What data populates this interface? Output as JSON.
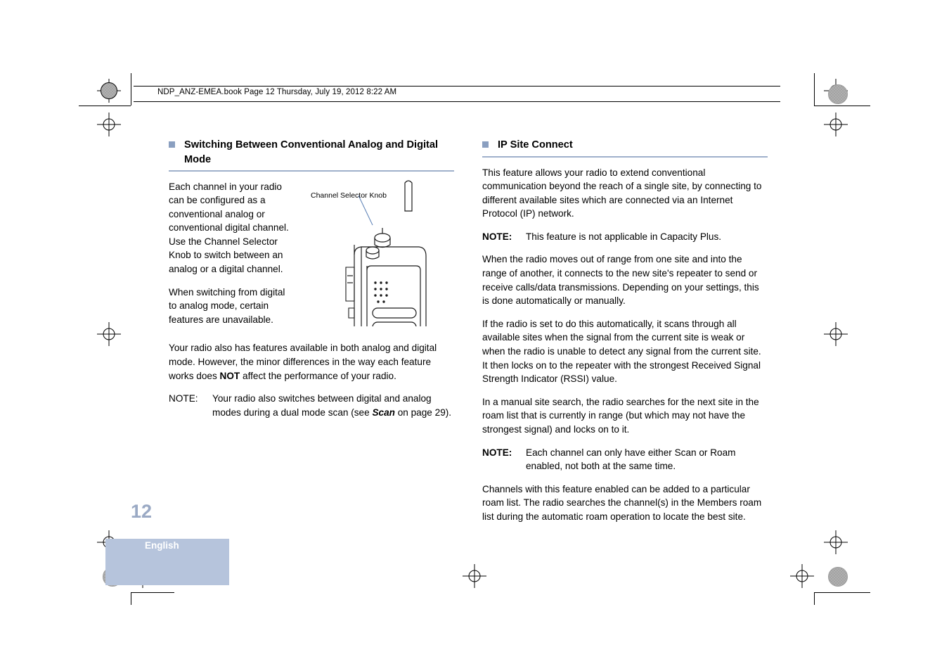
{
  "header": {
    "file_line": "NDP_ANZ-EMEA.book  Page 12  Thursday, July 19, 2012  8:22 AM"
  },
  "left_column": {
    "heading": "Switching Between Conventional Analog and Digital Mode",
    "p1": "Each channel in your radio can be configured as a conventional analog or conventional digital channel. Use the Channel Selector Knob to switch between an analog or a digital channel.",
    "p2": "When switching from digital to analog mode, certain features are unavailable.",
    "p3_part1": "Your radio also has features available in both analog and digital mode. However, the minor differences in the way each feature works does ",
    "p3_bold": "NOT",
    "p3_part2": " affect the performance of your radio.",
    "note_label": "NOTE:",
    "note_part1": "Your radio also switches between digital and analog modes during a dual mode scan (see ",
    "note_italic": "Scan",
    "note_part2": " on page 29)."
  },
  "figure": {
    "caption": "Channel Selector Knob",
    "alt": "Line drawing of a two-way radio with a callout to the channel selector knob on top"
  },
  "right_column": {
    "heading": "IP Site Connect",
    "p1": "This feature allows your radio to extend conventional communication beyond the reach of a single site, by connecting to different available sites which are connected via an Internet Protocol (IP) network.",
    "note1_label": "NOTE:",
    "note1_text": "This feature is not applicable in Capacity Plus.",
    "p2": "When the radio moves out of range from one site and into the range of another, it connects to the new site's repeater to send or receive calls/data transmissions. Depending on your settings, this is done automatically or manually.",
    "p3": "If the radio is set to do this automatically, it scans through all available sites when the signal from the current site is weak or when the radio is unable to detect any signal from the current site. It then locks on to the repeater with the strongest Received Signal Strength Indicator (RSSI) value.",
    "p4": "In a manual site search, the radio searches for the next site in the roam list that is currently in range (but which may not have the strongest signal) and locks on to it.",
    "note2_label": "NOTE:",
    "note2_text": "Each channel can only have either Scan or Roam enabled, not both at the same time.",
    "p5": "Channels with this feature enabled can be added to a particular roam list. The radio searches the channel(s) in the Members roam list during the automatic roam operation to locate the best site."
  },
  "footer": {
    "page_number": "12",
    "language": "English"
  },
  "colors": {
    "accent_rule": "#9fb0cb",
    "heading_bullet": "#8a9fc0",
    "tab_background": "#b6c4dc",
    "page_number": "#9aa9c4"
  }
}
